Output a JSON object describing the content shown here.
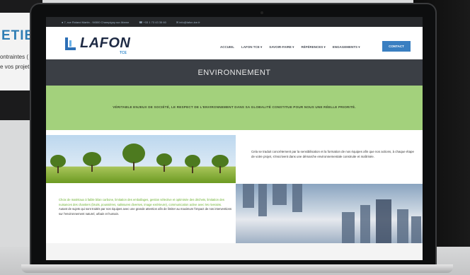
{
  "background": {
    "left_title": "ETIEF",
    "left_lines": [
      "ontraintes (",
      "e vos projet"
    ]
  },
  "topbar": {
    "address": "7, rue Roland Martin - 94500 Champigny-sur-Marne",
    "phone": "+33 1 73 43 35 60",
    "email": "info@lafon-tce.fr"
  },
  "brand": {
    "name": "LAFON",
    "sub": "TCE"
  },
  "nav": {
    "items": [
      "ACCUEIL",
      "LAFON TCE ▾",
      "SAVOIR-FAIRE ▾",
      "RÉFÉRENCES ▾",
      "ENGAGEMENTS ▾"
    ],
    "contact": "CONTACT"
  },
  "banner": {
    "title": "ENVIRONNEMENT"
  },
  "highlight": {
    "text": "VÉRITABLE ENJEUX DE SOCIÉTÉ, LE RESPECT DE L'ENVIRONNEMENT DANS SA GLOBALITÉ CONSTITUE POUR NOUS UNE RÉELLE PRIORITÉ."
  },
  "section1": {
    "text": "Cela se traduit concrètement par la sensibilisation et la formation de nos équipes afin que nos actions, à chaque étape de votre projet, s'inscrivent dans une démarche environnementale construite et maîtrisée."
  },
  "section2": {
    "green_text": "Choix de matériaux à faible bilan carbone, limitation des emballages, gestion sélective et optimisée des déchets, limitation des nuisances des chantiers (bruits, poussières, salissures diverses, image extérieure), communication active avec les riverains.",
    "dark_text": "Autant de sujets qui sont traités par nos équipes avec une grande attention afin de limiter au maximum l'impact de nos interventions sur l'environnement naturel, urbain et humain."
  },
  "colors": {
    "accent_green": "#a3d17c",
    "banner_gray": "#3b3f45",
    "brand_blue": "#3a7fc1",
    "text_green": "#6bb02e"
  }
}
